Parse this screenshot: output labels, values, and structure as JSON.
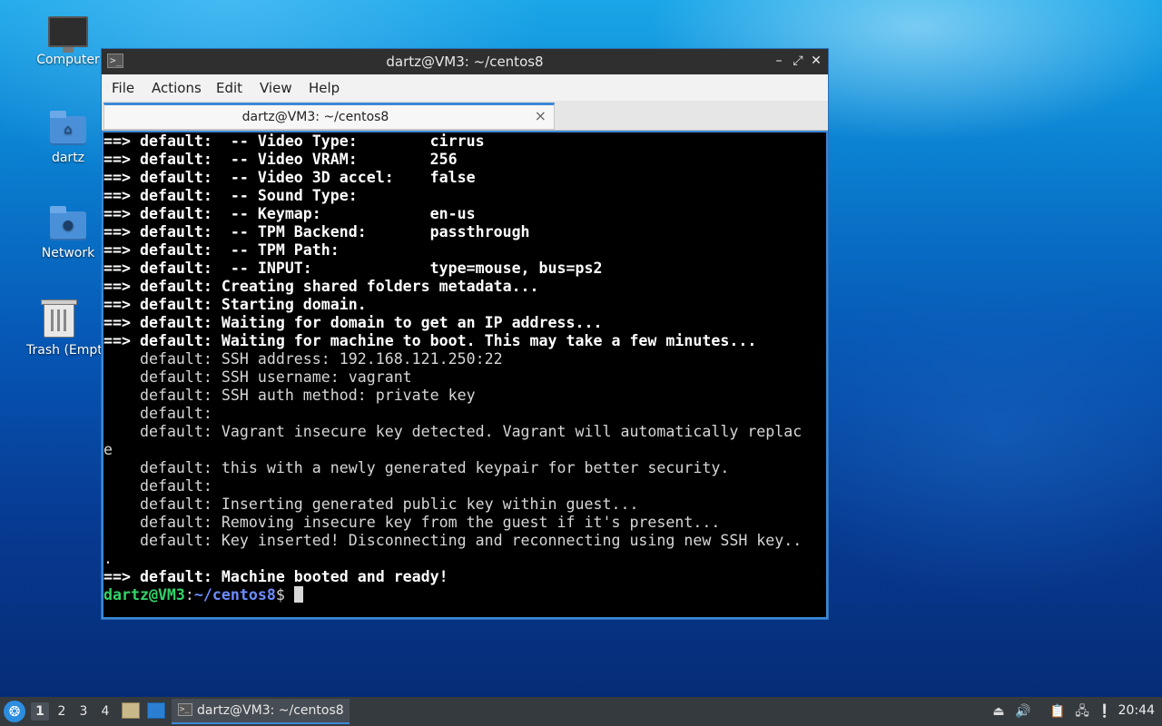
{
  "desktop": {
    "icons": [
      {
        "label": "Computer",
        "icon": "computer-icon"
      },
      {
        "label": "dartz",
        "icon": "home-folder-icon"
      },
      {
        "label": "Network",
        "icon": "network-folder-icon"
      },
      {
        "label": "Trash (Empt",
        "icon": "trash-icon"
      }
    ]
  },
  "window": {
    "title": "dartz@VM3: ~/centos8",
    "menu": [
      "File",
      "Actions",
      "Edit",
      "Help"
    ],
    "menu_view": "View",
    "tab": {
      "label": "dartz@VM3: ~/centos8",
      "close": "×"
    },
    "controls": {
      "minimize": "–",
      "maximize": "⤢",
      "close": "✕"
    },
    "accent_color": "#3c88d6"
  },
  "terminal": {
    "lines": [
      {
        "arrow": "==> ",
        "text": "default:  -- Video Type:        cirrus"
      },
      {
        "arrow": "==> ",
        "text": "default:  -- Video VRAM:        256"
      },
      {
        "arrow": "==> ",
        "text": "default:  -- Video 3D accel:    false"
      },
      {
        "arrow": "==> ",
        "text": "default:  -- Sound Type:"
      },
      {
        "arrow": "==> ",
        "text": "default:  -- Keymap:            en-us"
      },
      {
        "arrow": "==> ",
        "text": "default:  -- TPM Backend:       passthrough"
      },
      {
        "arrow": "==> ",
        "text": "default:  -- TPM Path:"
      },
      {
        "arrow": "==> ",
        "text": "default:  -- INPUT:             type=mouse, bus=ps2"
      },
      {
        "arrow": "==> ",
        "text": "default: Creating shared folders metadata..."
      },
      {
        "arrow": "==> ",
        "text": "default: Starting domain."
      },
      {
        "arrow": "==> ",
        "text": "default: Waiting for domain to get an IP address..."
      },
      {
        "arrow": "==> ",
        "text": "default: Waiting for machine to boot. This may take a few minutes..."
      },
      {
        "arrow": "    ",
        "text": "default: SSH address: 192.168.121.250:22"
      },
      {
        "arrow": "    ",
        "text": "default: SSH username: vagrant"
      },
      {
        "arrow": "    ",
        "text": "default: SSH auth method: private key"
      },
      {
        "arrow": "    ",
        "text": "default:"
      },
      {
        "arrow": "    ",
        "text": "default: Vagrant insecure key detected. Vagrant will automatically replac"
      },
      {
        "arrow": "",
        "text": "e"
      },
      {
        "arrow": "    ",
        "text": "default: this with a newly generated keypair for better security."
      },
      {
        "arrow": "    ",
        "text": "default:"
      },
      {
        "arrow": "    ",
        "text": "default: Inserting generated public key within guest..."
      },
      {
        "arrow": "    ",
        "text": "default: Removing insecure key from the guest if it's present..."
      },
      {
        "arrow": "    ",
        "text": "default: Key inserted! Disconnecting and reconnecting using new SSH key.."
      },
      {
        "arrow": "",
        "text": "."
      },
      {
        "arrow": "==> ",
        "text": "default: Machine booted and ready!"
      }
    ],
    "prompt": {
      "user_host": "dartz@VM3",
      "sep": ":",
      "path": "~/centos8",
      "symbol": "$"
    }
  },
  "taskbar": {
    "workspaces": [
      "1",
      "2",
      "3",
      "4"
    ],
    "active_workspace": "1",
    "task_label": "dartz@VM3: ~/centos8",
    "clock": "20:44"
  }
}
